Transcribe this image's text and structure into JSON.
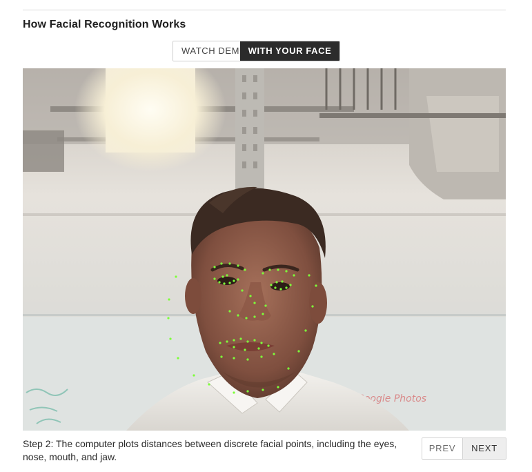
{
  "section": {
    "title": "How Facial Recognition Works"
  },
  "mode_toggle": {
    "options": [
      {
        "label": "WATCH DEMO",
        "active": false
      },
      {
        "label": "WITH YOUR FACE",
        "active": true
      }
    ]
  },
  "camera": {
    "whiteboard_text": "Google Photos",
    "landmark_color": "#7dff3a"
  },
  "step": {
    "caption": "Step 2: The computer plots distances between discrete facial points, including the eyes, nose, mouth, and jaw."
  },
  "pager": {
    "prev_label": "PREV",
    "next_label": "NEXT"
  },
  "colors": {
    "active_toggle_bg": "#2b2b2b",
    "rule": "#d8d8d8"
  }
}
